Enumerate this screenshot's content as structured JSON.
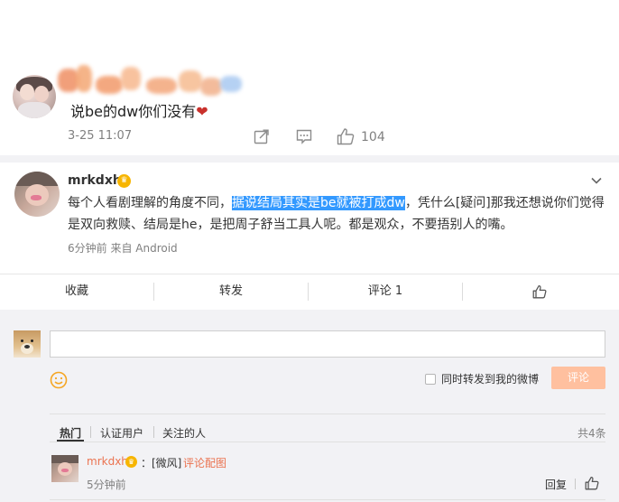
{
  "post": {
    "text": "说be的dw你们没有",
    "time": "3-25 11:07",
    "like_count": "104"
  },
  "comment": {
    "username": "mrkdxh",
    "text_before": "每个人看剧理解的角度不同，",
    "text_highlight": "据说结局其实是be就被打成dw",
    "text_after": "，凭什么[疑问]那我还想说你们觉得是双向救赎、结局是he，是把周子舒当工具人呢。都是观众，不要捂别人的嘴。",
    "meta": "6分钟前  来自 Android"
  },
  "actions": {
    "favorite": "收藏",
    "repost": "转发",
    "comment": "评论 1"
  },
  "composer": {
    "forward_label": "同时转发到我的微博",
    "submit_label": "评论"
  },
  "tabs": {
    "hot": "热门",
    "verified": "认证用户",
    "following": "关注的人",
    "total": "共4条"
  },
  "reply": {
    "username": "mrkdxh",
    "text": "：[微风]",
    "link": "评论配图",
    "time": "5分钟前",
    "reply_label": "回复"
  },
  "colors": {
    "accent": "#eb7350",
    "highlight": "#3399ff",
    "button_disabled": "#ffc09f",
    "heart": "#c9312c",
    "crown": "#f7b500"
  },
  "icons": {
    "share": "share-icon",
    "comment": "comment-icon",
    "like": "thumbs-up-icon",
    "expand": "chevron-down-icon",
    "emoji": "smile-icon",
    "badge": "crown-icon",
    "heart": "heart-icon"
  }
}
